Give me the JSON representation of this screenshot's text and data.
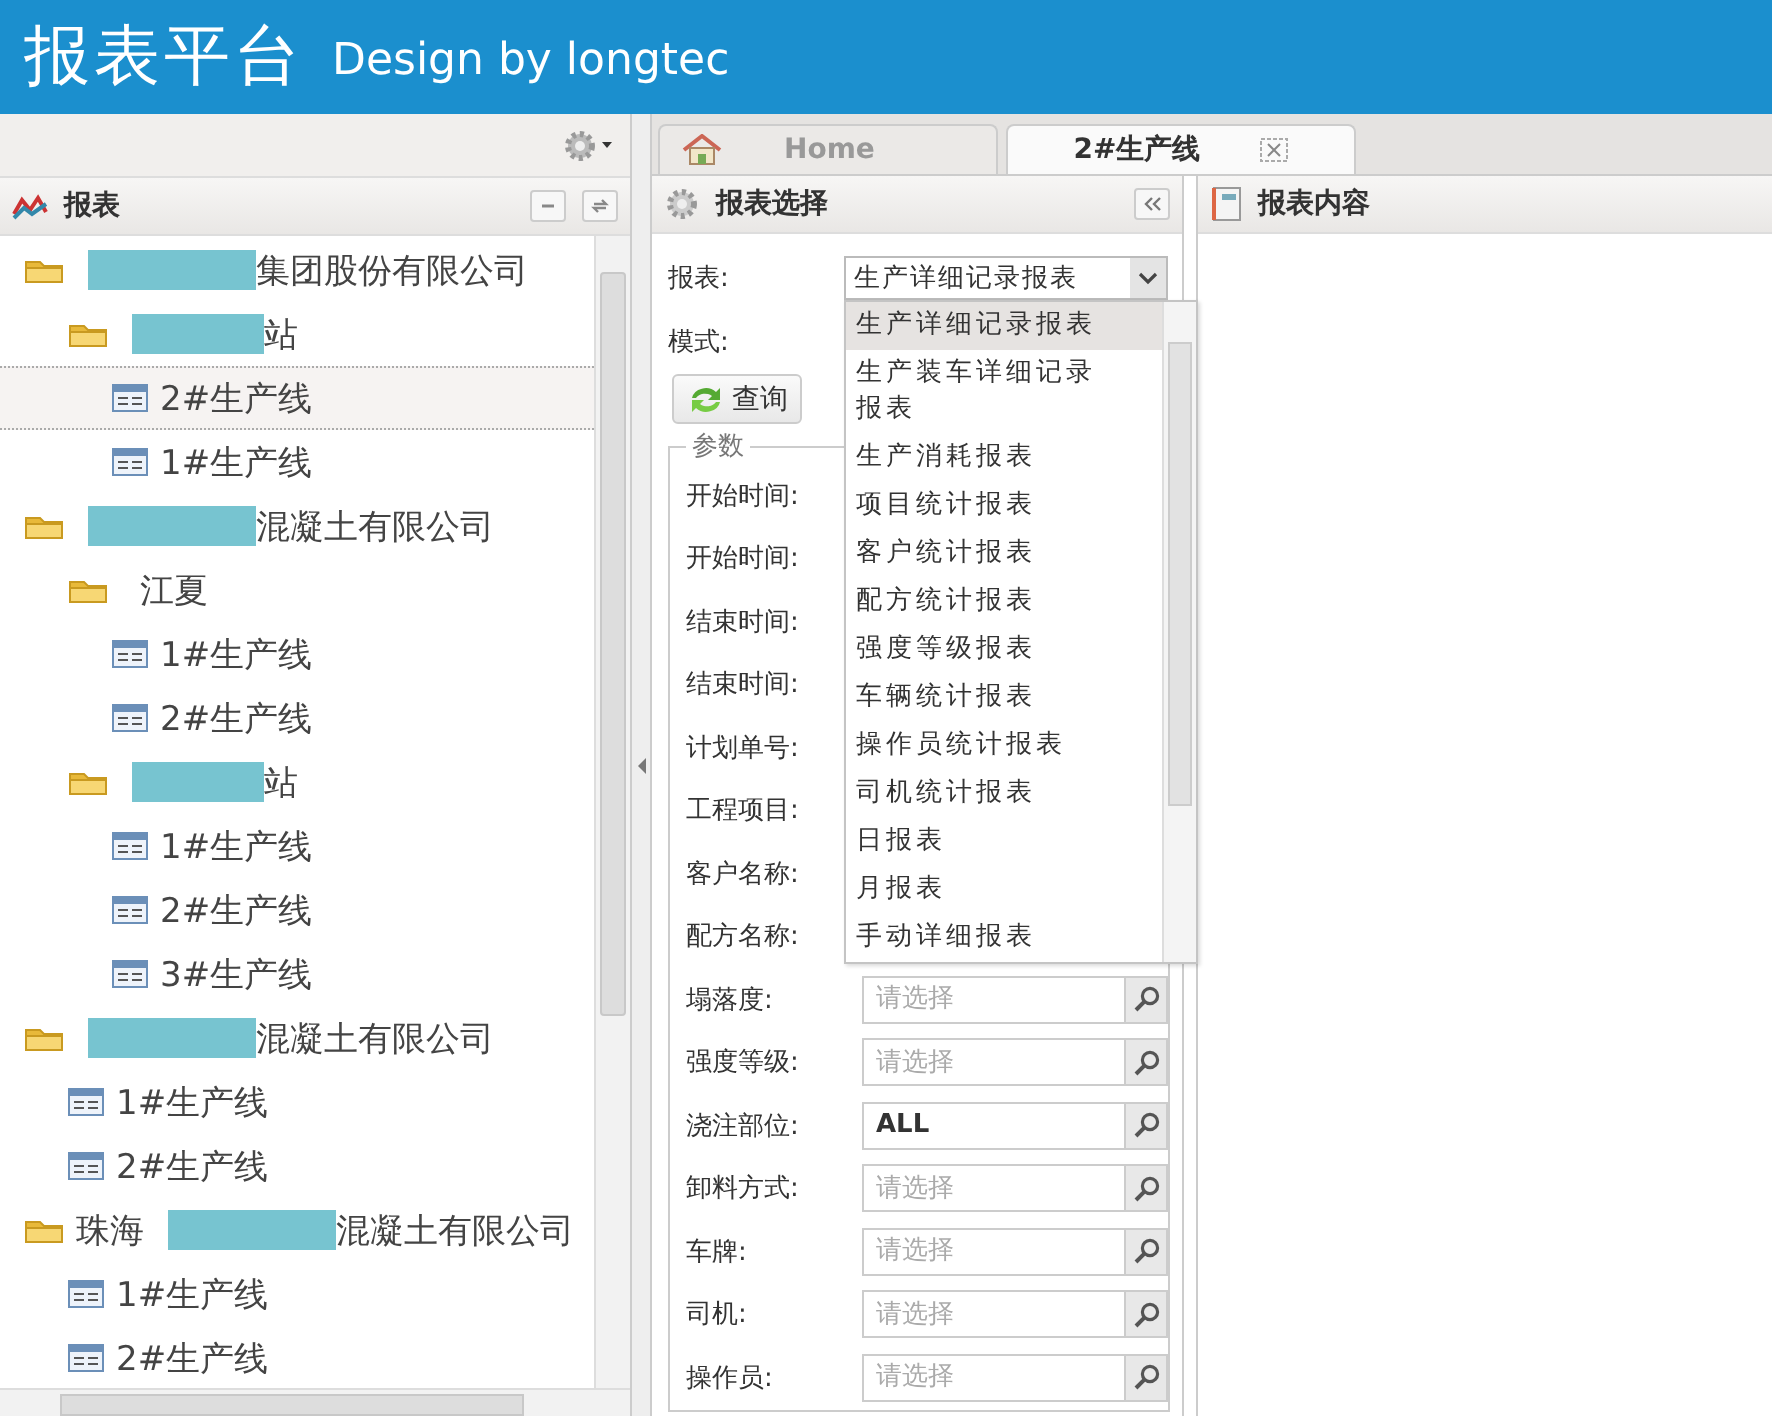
{
  "header": {
    "title": "报表平台",
    "subtitle": "Design by longtec"
  },
  "tree": {
    "title": "报表",
    "items": [
      {
        "label": "集团股份有限公司",
        "redacted": true,
        "selected": false,
        "children": [
          {
            "label": "站",
            "redacted": true,
            "selected": false,
            "children": [
              {
                "label": "2#生产线",
                "selected": true
              },
              {
                "label": "1#生产线",
                "selected": false
              }
            ]
          }
        ]
      },
      {
        "label": "混凝土有限公司",
        "redacted": true,
        "selected": false,
        "children": [
          {
            "label": "江夏",
            "selected": false,
            "children": [
              {
                "label": "1#生产线",
                "selected": false
              },
              {
                "label": "2#生产线",
                "selected": false
              }
            ]
          },
          {
            "label": "站",
            "redacted": true,
            "selected": false,
            "children": [
              {
                "label": "1#生产线",
                "selected": false
              },
              {
                "label": "2#生产线",
                "selected": false
              },
              {
                "label": "3#生产线",
                "selected": false
              }
            ]
          }
        ]
      },
      {
        "label": "混凝土有限公司",
        "redacted": true,
        "selected": false,
        "children": [
          {
            "label": "1#生产线",
            "selected": false
          },
          {
            "label": "2#生产线",
            "selected": false
          }
        ]
      },
      {
        "prefix": "珠海",
        "label": "混凝土有限公司",
        "redacted": true,
        "selected": false,
        "children": [
          {
            "label": "1#生产线",
            "selected": false
          },
          {
            "label": "2#生产线",
            "selected": false
          }
        ]
      }
    ]
  },
  "tabs": [
    {
      "label": "Home",
      "kind": "home",
      "selected": false,
      "closable": false
    },
    {
      "label": "2#生产线",
      "kind": "page",
      "selected": true,
      "closable": true
    }
  ],
  "report_panel": {
    "title": "报表选择",
    "report_label": "报表:",
    "report_value": "生产详细记录报表",
    "mode_label": "模式:",
    "query_button": "查询",
    "params_legend": "参数",
    "options": [
      {
        "label": "生产详细记录报表",
        "selected": true
      },
      {
        "label": "生产装车详细记录报表",
        "selected": false
      },
      {
        "label": "生产消耗报表",
        "selected": false
      },
      {
        "label": "项目统计报表",
        "selected": false
      },
      {
        "label": "客户统计报表",
        "selected": false
      },
      {
        "label": "配方统计报表",
        "selected": false
      },
      {
        "label": "强度等级报表",
        "selected": false
      },
      {
        "label": "车辆统计报表",
        "selected": false
      },
      {
        "label": "操作员统计报表",
        "selected": false
      },
      {
        "label": "司机统计报表",
        "selected": false
      },
      {
        "label": "日报表",
        "selected": false
      },
      {
        "label": "月报表",
        "selected": false
      },
      {
        "label": "手动详细报表",
        "selected": false
      }
    ],
    "params": [
      {
        "label": "开始时间:"
      },
      {
        "label": "开始时间:"
      },
      {
        "label": "结束时间:"
      },
      {
        "label": "结束时间:"
      },
      {
        "label": "计划单号:"
      },
      {
        "label": "工程项目:"
      },
      {
        "label": "客户名称:"
      },
      {
        "label": "配方名称:"
      },
      {
        "label": "塌落度:",
        "placeholder": "请选择"
      },
      {
        "label": "强度等级:",
        "placeholder": "请选择"
      },
      {
        "label": "浇注部位:",
        "value": "ALL"
      },
      {
        "label": "卸料方式:",
        "placeholder": "请选择"
      },
      {
        "label": "车牌:",
        "placeholder": "请选择"
      },
      {
        "label": "司机:",
        "placeholder": "请选择"
      },
      {
        "label": "操作员:",
        "placeholder": "请选择"
      }
    ]
  },
  "content_panel": {
    "title": "报表内容"
  }
}
